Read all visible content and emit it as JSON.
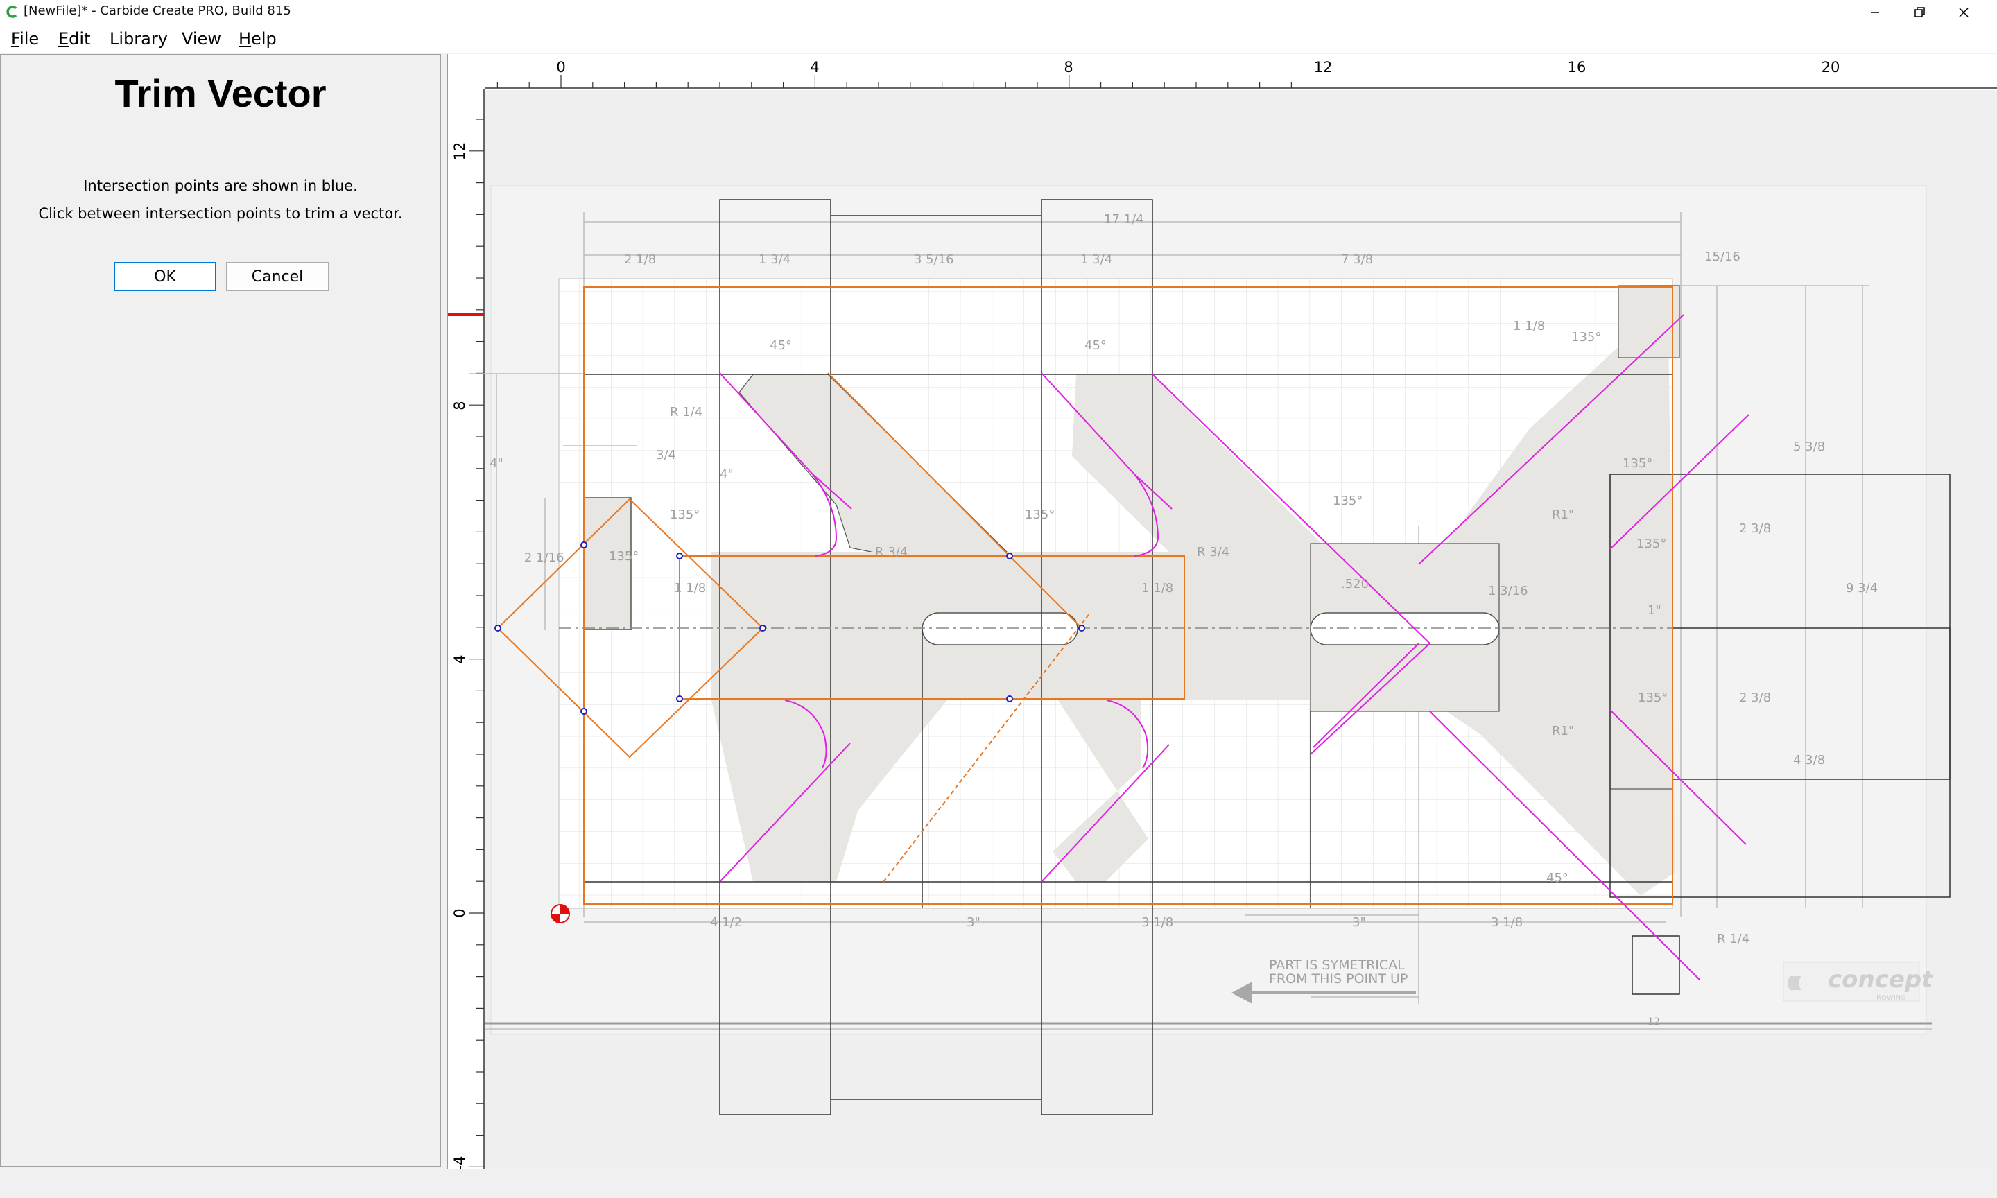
{
  "window": {
    "title": "[NewFile]* - Carbide Create PRO, Build 815",
    "icons": [
      "carbide-logo-icon",
      "minimize-icon",
      "restore-icon",
      "close-icon"
    ]
  },
  "menu": [
    {
      "name": "file",
      "label": "File",
      "u": "F",
      "rest": "ile"
    },
    {
      "name": "edit",
      "label": "Edit",
      "u": "E",
      "rest": "dit"
    },
    {
      "name": "library",
      "label": "Library"
    },
    {
      "name": "view",
      "label": "View"
    },
    {
      "name": "help",
      "label": "Help",
      "u": "H",
      "rest": "elp"
    }
  ],
  "panel": {
    "title": "Trim Vector",
    "line1": "Intersection points are shown in blue.",
    "line2": "Click between intersection points to trim a vector.",
    "ok_label": "OK",
    "cancel_label": "Cancel"
  },
  "ruler": {
    "x_labels": [
      "0",
      "4",
      "8",
      "12",
      "16",
      "20"
    ],
    "y_labels": [
      "12",
      "8",
      "4",
      "0",
      "-4"
    ]
  },
  "drawing": {
    "angle_labels": [
      "45°",
      "45°",
      "135°",
      "135°",
      "135°",
      "135°",
      "135°",
      "135°",
      "135°",
      "135°",
      "45°"
    ],
    "dims": {
      "d_17_1_4": "17 1/4",
      "d_2_1_8": "2 1/8",
      "d_1_3_4": "1 3/4",
      "d_3_5_16": "3 5/16",
      "d_7_3_8": "7 3/8",
      "d_15_16": "15/16",
      "d_3_4": "3/4",
      "d_2_1_16": "2 1/16",
      "d_1_1_8": "1 1/8",
      "d_R3_4": "R 3/4",
      "d_R1_4": "R 1/4",
      "d_R1": "R1\"",
      "d_520": ".520",
      "d_1_3_16": "1 3/16",
      "d_5_3_8": "5 3/8",
      "d_2_3_8": "2 3/8",
      "d_9_3_4": "9 3/4",
      "d_4_3_8": "4 3/8",
      "d_1in": "1\"",
      "d_4": "4\"",
      "d_4_1_2": "4 1/2",
      "d_3": "3\"",
      "d_3_1_8": "3 1/8",
      "d_12": "12"
    },
    "note_line1": "PART IS SYMETRICAL",
    "note_line2": "FROM THIS POINT UP",
    "logo_text": "concept",
    "logo_sub": "ROWING"
  },
  "colors": {
    "accent": "#0078d7",
    "vector_orange": "#e87722",
    "trim_magenta": "#e020e0",
    "intersection_blue": "#2020c0",
    "part_fill": "#e8e6e2",
    "origin_red": "#e01010"
  }
}
